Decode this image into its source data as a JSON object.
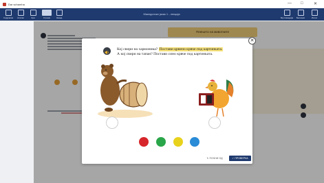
{
  "window": {
    "title": "Dar schamha",
    "controls": [
      "—",
      "□",
      "✕"
    ]
  },
  "toolbar": {
    "left_items": [
      {
        "label": "Содржина",
        "icon": "grid-icon"
      },
      {
        "label": "Алатки",
        "icon": "tools-icon"
      },
      {
        "label": "Зум",
        "icon": "zoom-icon"
      },
      {
        "label": "Страни",
        "icon": "pages-icon"
      },
      {
        "label": "Назад",
        "icon": "arrow-icon"
      }
    ],
    "center_text": "Македонски јазик 1 - лекција",
    "right_items": [
      {
        "label": "Мултимедија",
        "icon": "media-icon"
      },
      {
        "label": "Белешки",
        "icon": "notes-icon"
      },
      {
        "label": "Излез",
        "icon": "exit-icon"
      }
    ]
  },
  "background": {
    "banner": "Пеењето на животните"
  },
  "modal": {
    "question_line1_prefix": "Кој свири на хармоника? ",
    "question_line1_highlight": "Постави црвено крвче под картинката.",
    "question_line2": "А кој свири на тапан? Постави сино крвче под картинката.",
    "color_choices": [
      {
        "name": "red",
        "color": "#d7262b"
      },
      {
        "name": "green",
        "color": "#2aa64a"
      },
      {
        "name": "yellow",
        "color": "#e8d21c"
      },
      {
        "name": "blue",
        "color": "#2a8bd6"
      }
    ],
    "restart_label": "↻ ПОЧНИ ОД",
    "check_label": "✓ ПРОВЕРКА"
  },
  "colors": {
    "toolbar": "#1f3a6e",
    "highlight": "#f6e17a",
    "check_button": "#1f3a6e"
  }
}
